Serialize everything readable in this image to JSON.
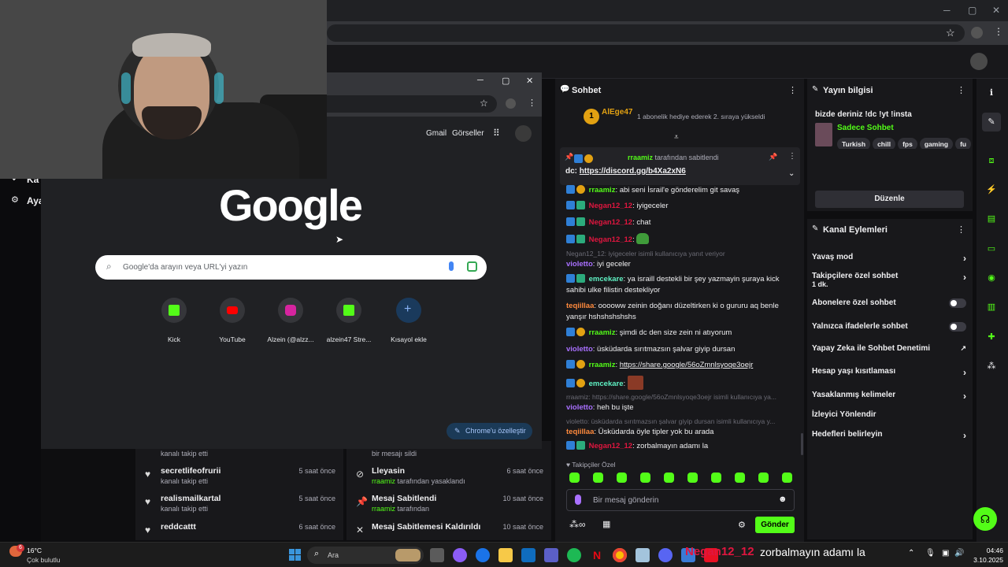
{
  "outer_browser": {
    "min": "─",
    "max": "▢",
    "close": "✕"
  },
  "kick_bg_sidebar": {
    "item1": "Ka",
    "item2": "Aya"
  },
  "chat": {
    "title": "Sohbet",
    "pinned_event": {
      "user": "AlEge47",
      "level": "1",
      "text": "1 abonelik hediye ederek 2. sıraya yükseldi"
    },
    "pinned": {
      "by_user": "rraamiz",
      "by_text": "tarafından sabitlendi",
      "text": "dc: ",
      "link": "https://discord.gg/b4Xa2xN6"
    },
    "messages": [
      {
        "user": "rraamiz",
        "text": ": abi seni İsrail'e gönderelim git savaş"
      },
      {
        "user": "Negan12_12",
        "text": ": iyigeceler"
      },
      {
        "user": "Negan12_12",
        "text": ": chat"
      },
      {
        "user": "Negan12_12",
        "text": ":"
      },
      {
        "reply": "Negan12_12: iyigeceler isimli kullanıcıya yanıt veriyor",
        "user": "violetto",
        "text": ": iyi geceler"
      },
      {
        "user": "emcekare",
        "text": ": ya israill destekli bir şey yazmayin şuraya kick sahibi ulke filistin destekliyor"
      },
      {
        "user": "teqiillaa",
        "text": ": ooooww zeinin doğanı düzeltirken ki o gururu aq benle yanşır hshshshshshs"
      },
      {
        "user": "rraamiz",
        "text": ": şimdi dc den size zein ni atıyorum"
      },
      {
        "user": "violetto",
        "text": ": üsküdarda sırıtmazsın şalvar giyip dursan"
      },
      {
        "user": "rraamiz",
        "text": ": ",
        "link": "https://share.google/56oZmnlsyoqe3oejr"
      },
      {
        "user": "emcekare",
        "text": ":"
      },
      {
        "reply": "rraamiz: https://share.google/56oZmnlsyoqe3oejr isimli kullanıcıya ya...",
        "user": "violetto",
        "text": ": heh bu işte"
      },
      {
        "reply": "violetto: üsküdarda sırıtmazsın şalvar giyip dursan isimli kullanıcıya y...",
        "user": "teqiillaa",
        "text": ": Üsküdarda öyle tipler yok bu arada"
      },
      {
        "user": "Negan12_12",
        "text": ": zorbalmayın adamı la"
      }
    ],
    "follower_emotes_label": "Takipçiler Özel",
    "input_placeholder": "Bir mesaj gönderin",
    "send": "Gönder"
  },
  "info": {
    "title": "Yayın bilgisi",
    "stream_title": "bizde deriniz !dc !yt !insta",
    "category": "Sadece Sohbet",
    "tags": [
      "Turkish",
      "chill",
      "fps",
      "gaming",
      "fu"
    ],
    "edit": "Düzenle",
    "actions_title": "Kanal Eylemleri",
    "actions": [
      {
        "label": "Yavaş mod"
      },
      {
        "label": "Takipçilere özel sohbet",
        "sub": "1 dk."
      },
      {
        "label": "Abonelere özel sohbet"
      },
      {
        "label": "Yalnızca ifadelerle sohbet"
      },
      {
        "label": "Yapay Zeka ile Sohbet Denetimi"
      },
      {
        "label": "Hesap yaşı kısıtlaması"
      },
      {
        "label": "Yasaklanmış kelimeler"
      },
      {
        "label": "İzleyici Yönlendir"
      },
      {
        "label": "Hedefleri belirleyin"
      }
    ]
  },
  "feed_left": [
    {
      "name": "",
      "sub": "kanalı takip etti",
      "time": ""
    },
    {
      "name": "secretlifeofrurii",
      "sub": "kanalı takip etti",
      "time": "5 saat önce"
    },
    {
      "name": "realismailkartal",
      "sub": "kanalı takip etti",
      "time": "5 saat önce"
    },
    {
      "name": "reddcattt",
      "sub": "",
      "time": "6 saat önce"
    }
  ],
  "feed_right": [
    {
      "name": "",
      "sub": "bir mesajı sildi",
      "time": ""
    },
    {
      "name": "Lleyasin",
      "sub_user": "rraamiz",
      "sub": "tarafından yasaklandı",
      "time": "6 saat önce"
    },
    {
      "name": "Mesaj Sabitlendi",
      "sub_user": "rraamiz",
      "sub": "tarafından",
      "time": "10 saat önce"
    },
    {
      "name": "Mesaj Sabitlemesi Kaldırıldı",
      "sub": "",
      "time": "10 saat önce"
    }
  ],
  "inner_chrome": {
    "header_links": [
      "Gmail",
      "Görseller"
    ],
    "logo": "Google",
    "search_placeholder": "Google'da arayın veya URL'yi yazın",
    "shortcuts": [
      {
        "label": "Kick"
      },
      {
        "label": "YouTube"
      },
      {
        "label": "Alzein (@alzz..."
      },
      {
        "label": "alzein47 Stre..."
      },
      {
        "label": "Kısayol ekle"
      }
    ],
    "customize": "Chrome'u özelleştir"
  },
  "taskbar": {
    "weather_temp": "16°C",
    "weather_text": "Çok bulutlu",
    "weather_badge": "6",
    "search": "Ara",
    "overlay_user": "Negan12_12",
    "overlay_text": "zorbalmayın adamı la",
    "time": "04:46",
    "date": "3.10.2025"
  },
  "colors": {
    "kick_green": "#53fc18",
    "bg": "#0e0e10",
    "panel": "#18181b"
  }
}
